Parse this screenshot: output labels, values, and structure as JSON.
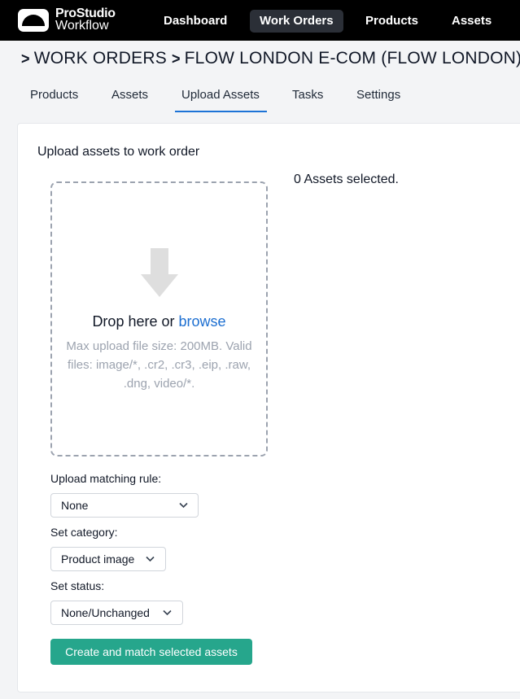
{
  "app": {
    "logo_line1": "ProStudio",
    "logo_line2": "Workflow"
  },
  "nav": {
    "dashboard": "Dashboard",
    "work_orders": "Work Orders",
    "products": "Products",
    "assets": "Assets",
    "active": "Work Orders"
  },
  "breadcrumb": {
    "items": [
      "WORK ORDERS",
      "FLOW LONDON E-COM (FLOW LONDON)"
    ]
  },
  "tabs": {
    "products": "Products",
    "assets": "Assets",
    "upload_assets": "Upload Assets",
    "tasks": "Tasks",
    "settings": "Settings",
    "active": "Upload Assets"
  },
  "upload": {
    "title": "Upload assets to work order",
    "selected_count": "0 Assets selected.",
    "drop_text": "Drop here or",
    "browse_label": "browse",
    "hint": "Max upload file size: 200MB. Valid files: image/*, .cr2, .cr3, .eip, .raw, .dng, video/*."
  },
  "form": {
    "matching_rule_label": "Upload matching rule:",
    "matching_rule_value": "None",
    "category_label": "Set category:",
    "category_value": "Product image",
    "status_label": "Set status:",
    "status_value": "None/Unchanged",
    "submit_label": "Create and match selected assets"
  },
  "colors": {
    "topbar": "#000000",
    "link": "#1d6fd1",
    "tab_underline": "#1d73d6",
    "primary_button": "#26a68c"
  },
  "icons": {
    "upload_arrow": "arrow-down-icon",
    "select_caret": "chevron-down-icon",
    "breadcrumb_separator": "chevron-right-icon"
  }
}
